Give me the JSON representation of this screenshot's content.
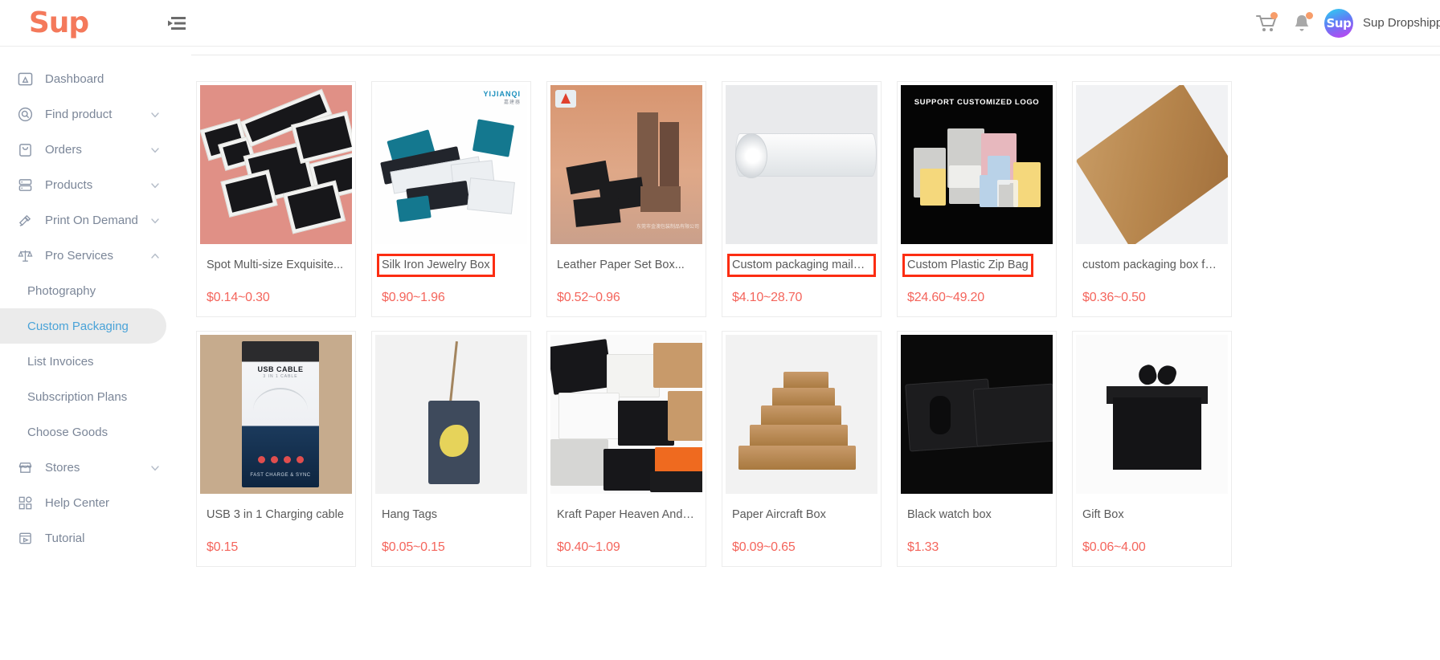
{
  "header": {
    "brand": "Sup",
    "collapse_icon": "collapse-menu-icon",
    "cart_icon": "shopping-cart-icon",
    "bell_icon": "notification-bell-icon",
    "avatar_text": "Sup",
    "user_name": "Sup Dropshippin",
    "badge_color": "#f79d6a"
  },
  "sidebar": {
    "items": [
      {
        "label": "Dashboard",
        "icon": "dashboard-icon",
        "expandable": false
      },
      {
        "label": "Find product",
        "icon": "search-circle-icon",
        "expandable": true,
        "expanded": false
      },
      {
        "label": "Orders",
        "icon": "orders-bag-icon",
        "expandable": true,
        "expanded": false
      },
      {
        "label": "Products",
        "icon": "products-stack-icon",
        "expandable": true,
        "expanded": false
      },
      {
        "label": "Print On Demand",
        "icon": "print-on-demand-icon",
        "expandable": true,
        "expanded": false
      },
      {
        "label": "Pro Services",
        "icon": "scales-icon",
        "expandable": true,
        "expanded": true
      }
    ],
    "sub_items": [
      {
        "label": "Photography",
        "active": false
      },
      {
        "label": "Custom Packaging",
        "active": true
      },
      {
        "label": "List Invoices",
        "active": false
      },
      {
        "label": "Subscription Plans",
        "active": false
      },
      {
        "label": "Choose Goods",
        "active": false
      }
    ],
    "bottom_items": [
      {
        "label": "Stores",
        "icon": "store-icon",
        "expandable": true,
        "expanded": false
      },
      {
        "label": "Help Center",
        "icon": "help-grid-icon",
        "expandable": false
      },
      {
        "label": "Tutorial",
        "icon": "tutorial-video-icon",
        "expandable": false
      }
    ],
    "active_text_color": "#4aa3d8",
    "active_bg_color": "#ebebeb"
  },
  "main": {
    "price_color": "#f4655c",
    "annotation_color": "#fc2d12",
    "products": [
      {
        "title": "Spot Multi-size Exquisite...",
        "price": "$0.14~0.30",
        "annotated": false,
        "art": "ph-jewelry"
      },
      {
        "title": "Silk Iron Jewelry Box",
        "price": "$0.90~1.96",
        "annotated": true,
        "art": "ph-silk",
        "image_logo": "YIJIANQI",
        "image_logo_sub": "嘉建器"
      },
      {
        "title": "Leather Paper Set Box...",
        "price": "$0.52~0.96",
        "annotated": false,
        "art": "ph-leather",
        "watermark": "东莞市金澳包装制品有限公司"
      },
      {
        "title": "Custom packaging mailer b...",
        "price": "$4.10~28.70",
        "annotated": true,
        "art": "ph-mailer"
      },
      {
        "title": "Custom Plastic Zip Bag",
        "price": "$24.60~49.20",
        "annotated": true,
        "art": "ph-zip",
        "caption": "SUPPORT CUSTOMIZED LOGO"
      },
      {
        "title": "custom packaging box for...",
        "price": "$0.36~0.50",
        "annotated": false,
        "art": "ph-kraft"
      },
      {
        "title": "USB 3 in 1 Charging cable",
        "price": "$0.15",
        "annotated": false,
        "art": "ph-usb",
        "pkg_title": "USB CABLE",
        "pkg_sub": "3 IN 1 CABLE",
        "pkg_foot": "FAST CHARGE & SYNC"
      },
      {
        "title": "Hang Tags",
        "price": "$0.05~0.15",
        "annotated": false,
        "art": "ph-tag"
      },
      {
        "title": "Kraft Paper Heaven And Ear...",
        "price": "$0.40~1.09",
        "annotated": false,
        "art": "ph-heaven"
      },
      {
        "title": "Paper Aircraft Box",
        "price": "$0.09~0.65",
        "annotated": false,
        "art": "ph-air"
      },
      {
        "title": "Black watch box",
        "price": "$1.33",
        "annotated": false,
        "art": "ph-watch"
      },
      {
        "title": "Gift Box",
        "price": "$0.06~4.00",
        "annotated": false,
        "art": "ph-gift"
      }
    ]
  }
}
